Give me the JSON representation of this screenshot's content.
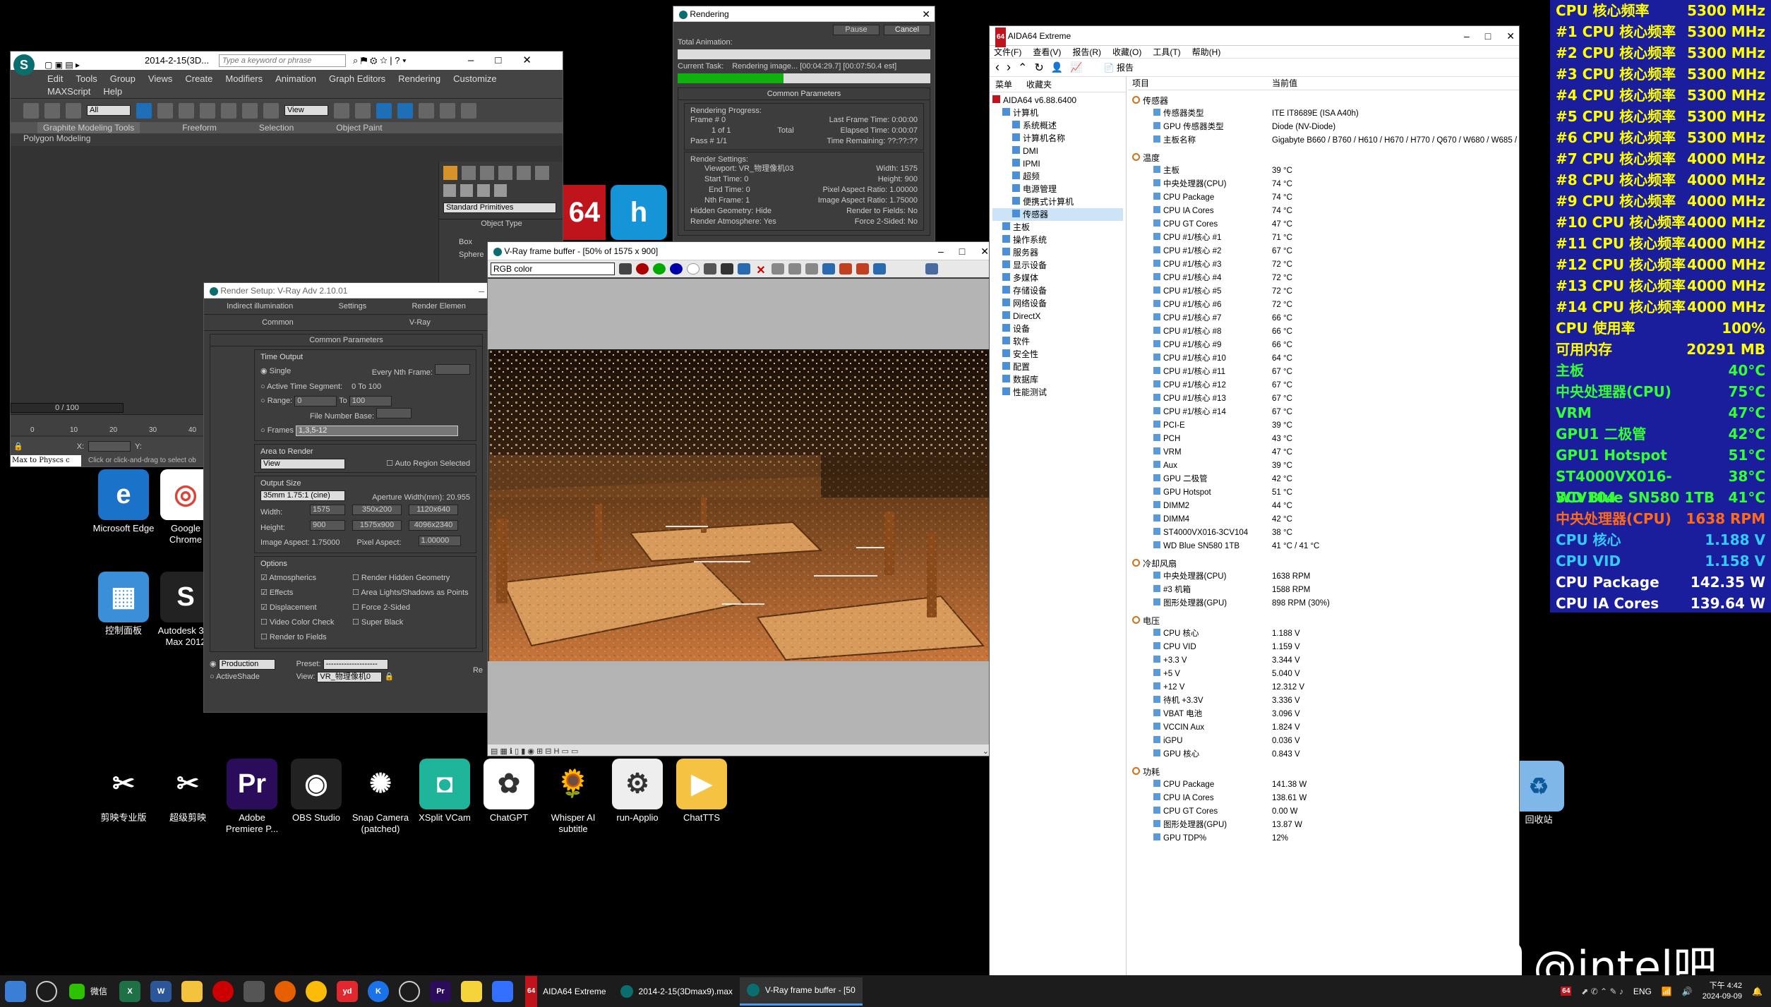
{
  "max": {
    "title": "2014-2-15(3D...",
    "search_placeholder": "Type a keyword or phrase",
    "menus": [
      "Edit",
      "Tools",
      "Group",
      "Views",
      "Create",
      "Modifiers",
      "Animation",
      "Graph Editors",
      "Rendering",
      "Customize"
    ],
    "menus2": [
      "MAXScript",
      "Help"
    ],
    "ribbon_tabs": [
      "Graphite Modeling Tools",
      "Freeform",
      "Selection",
      "Object Paint"
    ],
    "ribbon_sub": "Polygon Modeling",
    "view_dropdown": "View",
    "all_dropdown": "All",
    "frame_counter": "0 / 100",
    "timeline_ticks": [
      "0",
      "10",
      "20",
      "30",
      "40"
    ],
    "prompt": "Click or click-and-drag to select ob",
    "maxscript": "Max to Physcs c",
    "x_label": "X:",
    "y_label": "Y:",
    "standard_primitives": "Standard Primitives",
    "object_type": "Object Type",
    "box": "Box",
    "sphere": "Sphere"
  },
  "rendering": {
    "title": "Rendering",
    "pause": "Pause",
    "cancel": "Cancel",
    "total_animation": "Total Animation:",
    "current_task_label": "Current Task:",
    "current_task": "Rendering image... [00:04:29.7] [00:07:50.4 est]",
    "progress_fraction": 0.42,
    "common_params": "Common Parameters",
    "rendering_progress": "Rendering Progress:",
    "frame": "Frame #  0",
    "of": "1 of 1",
    "total": "Total",
    "pass": "Pass #  1/1",
    "last_frame_time": "Last Frame Time:  0:00:00",
    "elapsed_time": "Elapsed Time:  0:00:07",
    "time_remaining": "Time Remaining:  ??:??:??",
    "render_settings": "Render Settings:",
    "viewport": "Viewport:  VR_物理像机03",
    "width": "Width:  1575",
    "start_time": "Start Time:  0",
    "height": "Height:  900",
    "end_time": "End Time:  0",
    "pixel_aspect": "Pixel Aspect Ratio:  1.00000",
    "nth_frame": "Nth Frame:  1",
    "image_aspect": "Image Aspect Ratio:  1.75000",
    "hidden_geometry": "Hidden Geometry:  Hide",
    "render_to_fields": "Render to Fields:  No",
    "render_atmosphere": "Render Atmosphere:  Yes",
    "force_2sided": "Force 2-Sided:  No"
  },
  "rsetup": {
    "title": "Render Setup: V-Ray Adv 2.10.01",
    "tabs1": [
      "Indirect illumination",
      "Settings",
      "Render Elemen"
    ],
    "tabs2": [
      "Common",
      "V-Ray"
    ],
    "common_params": "Common Parameters",
    "time_output": "Time Output",
    "single": "Single",
    "every_nth": "Every Nth Frame:",
    "active_segment": "Active Time Segment:",
    "segment_value": "0 To 100",
    "range": "Range:",
    "range_from": "0",
    "range_to_label": "To",
    "range_to": "100",
    "file_number_base": "File Number Base:",
    "frames": "Frames",
    "frames_value": "1,3,5-12",
    "area_to_render": "Area to Render",
    "area_value": "View",
    "auto_region": "Auto Region Selected",
    "output_size": "Output Size",
    "camera_preset": "35mm 1.75:1 (cine)",
    "aperture": "Aperture Width(mm): 20.955",
    "width_label": "Width:",
    "width_val": "1575",
    "height_label": "Height:",
    "height_val": "900",
    "presets": [
      "350x200",
      "1120x640",
      "1575x900",
      "4096x2340"
    ],
    "image_aspect": "Image Aspect: 1.75000",
    "pixel_aspect": "Pixel Aspect:",
    "pixel_aspect_val": "1.00000",
    "options": "Options",
    "opts_left": [
      "Atmospherics",
      "Effects",
      "Displacement",
      "Video Color Check",
      "Render to Fields"
    ],
    "opts_left_checked": [
      true,
      true,
      true,
      false,
      false
    ],
    "opts_right": [
      "Render Hidden Geometry",
      "Area Lights/Shadows as Points",
      "Force 2-Sided",
      "Super Black"
    ],
    "production": "Production",
    "activeshade": "ActiveShade",
    "preset_label": "Preset:",
    "preset_val": "--------------------",
    "view_label": "View:",
    "view_val": "VR_物理像机0",
    "render_btn": "Re"
  },
  "vray": {
    "title": "V-Ray frame buffer - [50% of 1575 x 900]",
    "channel": "RGB color"
  },
  "aida": {
    "title": "AIDA64 Extreme",
    "menus": [
      "文件(F)",
      "查看(V)",
      "报告(R)",
      "收藏(O)",
      "工具(T)",
      "帮助(H)"
    ],
    "report": "报告",
    "left_tabs": [
      "菜单",
      "收藏夹"
    ],
    "col_item": "项目",
    "col_value": "当前值",
    "tree": [
      {
        "t": "AIDA64 v6.88.6400",
        "d": 0
      },
      {
        "t": "计算机",
        "d": 1
      },
      {
        "t": "系统概述",
        "d": 2
      },
      {
        "t": "计算机名称",
        "d": 2
      },
      {
        "t": "DMI",
        "d": 2
      },
      {
        "t": "IPMI",
        "d": 2
      },
      {
        "t": "超频",
        "d": 2
      },
      {
        "t": "电源管理",
        "d": 2
      },
      {
        "t": "便携式计算机",
        "d": 2
      },
      {
        "t": "传感器",
        "d": 2
      },
      {
        "t": "主板",
        "d": 1
      },
      {
        "t": "操作系统",
        "d": 1
      },
      {
        "t": "服务器",
        "d": 1
      },
      {
        "t": "显示设备",
        "d": 1
      },
      {
        "t": "多媒体",
        "d": 1
      },
      {
        "t": "存储设备",
        "d": 1
      },
      {
        "t": "网络设备",
        "d": 1
      },
      {
        "t": "DirectX",
        "d": 1
      },
      {
        "t": "设备",
        "d": 1
      },
      {
        "t": "软件",
        "d": 1
      },
      {
        "t": "安全性",
        "d": 1
      },
      {
        "t": "配置",
        "d": 1
      },
      {
        "t": "数据库",
        "d": 1
      },
      {
        "t": "性能测试",
        "d": 1
      }
    ],
    "sections": [
      {
        "name": "传感器",
        "rows": [
          [
            "传感器类型",
            "ITE IT8689E  (ISA A40h)"
          ],
          [
            "GPU 传感器类型",
            "Diode  (NV-Diode)"
          ],
          [
            "主板名称",
            "Gigabyte B660 / B760 / H610 / H670 / H770 / Q670 / W680 / W685 /"
          ]
        ]
      },
      {
        "name": "温度",
        "rows": [
          [
            "主板",
            "39 °C"
          ],
          [
            "中央处理器(CPU)",
            "74 °C"
          ],
          [
            "CPU Package",
            "74 °C"
          ],
          [
            "CPU IA Cores",
            "74 °C"
          ],
          [
            "CPU GT Cores",
            "47 °C"
          ],
          [
            "CPU #1/核心 #1",
            "71 °C"
          ],
          [
            "CPU #1/核心 #2",
            "67 °C"
          ],
          [
            "CPU #1/核心 #3",
            "72 °C"
          ],
          [
            "CPU #1/核心 #4",
            "72 °C"
          ],
          [
            "CPU #1/核心 #5",
            "72 °C"
          ],
          [
            "CPU #1/核心 #6",
            "72 °C"
          ],
          [
            "CPU #1/核心 #7",
            "66 °C"
          ],
          [
            "CPU #1/核心 #8",
            "66 °C"
          ],
          [
            "CPU #1/核心 #9",
            "66 °C"
          ],
          [
            "CPU #1/核心 #10",
            "64 °C"
          ],
          [
            "CPU #1/核心 #11",
            "67 °C"
          ],
          [
            "CPU #1/核心 #12",
            "67 °C"
          ],
          [
            "CPU #1/核心 #13",
            "67 °C"
          ],
          [
            "CPU #1/核心 #14",
            "67 °C"
          ],
          [
            "PCI-E",
            "39 °C"
          ],
          [
            "PCH",
            "43 °C"
          ],
          [
            "VRM",
            "47 °C"
          ],
          [
            "Aux",
            "39 °C"
          ],
          [
            "GPU 二极管",
            "42 °C"
          ],
          [
            "GPU Hotspot",
            "51 °C"
          ],
          [
            "DIMM2",
            "44 °C"
          ],
          [
            "DIMM4",
            "42 °C"
          ],
          [
            "ST4000VX016-3CV104",
            "38 °C"
          ],
          [
            "WD Blue SN580 1TB",
            "41 °C / 41 °C"
          ]
        ]
      },
      {
        "name": "冷却风扇",
        "rows": [
          [
            "中央处理器(CPU)",
            "1638 RPM"
          ],
          [
            "#3 机箱",
            "1588 RPM"
          ],
          [
            "图形处理器(GPU)",
            "898 RPM  (30%)"
          ]
        ]
      },
      {
        "name": "电压",
        "rows": [
          [
            "CPU 核心",
            "1.188 V"
          ],
          [
            "CPU VID",
            "1.159 V"
          ],
          [
            "+3.3 V",
            "3.344 V"
          ],
          [
            "+5 V",
            "5.040 V"
          ],
          [
            "+12 V",
            "12.312 V"
          ],
          [
            "待机 +3.3V",
            "3.336 V"
          ],
          [
            "VBAT 电池",
            "3.096 V"
          ],
          [
            "VCCIN Aux",
            "1.824 V"
          ],
          [
            "iGPU",
            "0.036 V"
          ],
          [
            "GPU 核心",
            "0.843 V"
          ]
        ]
      },
      {
        "name": "功耗",
        "rows": [
          [
            "CPU Package",
            "141.38 W"
          ],
          [
            "CPU IA Cores",
            "138.61 W"
          ],
          [
            "CPU GT Cores",
            "0.00 W"
          ],
          [
            "图形处理器(GPU)",
            "13.87 W"
          ],
          [
            "GPU TDP%",
            "12%"
          ]
        ]
      }
    ]
  },
  "osd": [
    {
      "k": "CPU 核心频率",
      "v": "5300 MHz",
      "c": "#ffff00"
    },
    {
      "k": "#1 CPU 核心频率",
      "v": "5300 MHz",
      "c": "#ffff00"
    },
    {
      "k": "#2 CPU 核心频率",
      "v": "5300 MHz",
      "c": "#ffff00"
    },
    {
      "k": "#3 CPU 核心频率",
      "v": "5300 MHz",
      "c": "#ffff00"
    },
    {
      "k": "#4 CPU 核心频率",
      "v": "5300 MHz",
      "c": "#ffff00"
    },
    {
      "k": "#5 CPU 核心频率",
      "v": "5300 MHz",
      "c": "#ffff00"
    },
    {
      "k": "#6 CPU 核心频率",
      "v": "5300 MHz",
      "c": "#ffff00"
    },
    {
      "k": "#7 CPU 核心频率",
      "v": "4000 MHz",
      "c": "#ffff00"
    },
    {
      "k": "#8 CPU 核心频率",
      "v": "4000 MHz",
      "c": "#ffff00"
    },
    {
      "k": "#9 CPU 核心频率",
      "v": "4000 MHz",
      "c": "#ffff00"
    },
    {
      "k": "#10 CPU 核心频率",
      "v": "4000 MHz",
      "c": "#ffff00"
    },
    {
      "k": "#11 CPU 核心频率",
      "v": "4000 MHz",
      "c": "#ffff00"
    },
    {
      "k": "#12 CPU 核心频率",
      "v": "4000 MHz",
      "c": "#ffff00"
    },
    {
      "k": "#13 CPU 核心频率",
      "v": "4000 MHz",
      "c": "#ffff00"
    },
    {
      "k": "#14 CPU 核心频率",
      "v": "4000 MHz",
      "c": "#ffff00"
    },
    {
      "k": "CPU 使用率",
      "v": "100%",
      "c": "#ffff00"
    },
    {
      "k": "可用内存",
      "v": "20291 MB",
      "c": "#ffff00"
    },
    {
      "k": "主板",
      "v": "40°C",
      "c": "#33ff33"
    },
    {
      "k": "中央处理器(CPU)",
      "v": "75°C",
      "c": "#33ff33"
    },
    {
      "k": "VRM",
      "v": "47°C",
      "c": "#33ff33"
    },
    {
      "k": "GPU1 二极管",
      "v": "42°C",
      "c": "#33ff33"
    },
    {
      "k": "GPU1 Hotspot",
      "v": "51°C",
      "c": "#33ff33"
    },
    {
      "k": "ST4000VX016-3CV104",
      "v": "38°C",
      "c": "#33ff33"
    },
    {
      "k": "WD Blue SN580 1TB",
      "v": "41°C",
      "c": "#33ff33"
    },
    {
      "k": "中央处理器(CPU)",
      "v": "1638 RPM",
      "c": "#ff6a1a"
    },
    {
      "k": "CPU 核心",
      "v": "1.188 V",
      "c": "#33ccff"
    },
    {
      "k": "CPU VID",
      "v": "1.158 V",
      "c": "#33ccff"
    },
    {
      "k": "CPU Package",
      "v": "142.35 W",
      "c": "#ffffff"
    },
    {
      "k": "CPU IA Cores",
      "v": "139.64 W",
      "c": "#ffffff"
    }
  ],
  "desktop_icons": [
    {
      "label": "Microsoft Edge",
      "bg": "#1a73c8",
      "glyph": "e"
    },
    {
      "label": "Google Chrome",
      "bg": "#fff",
      "glyph": "◎"
    },
    {
      "label": "控制面板",
      "bg": "#3a8fd8",
      "glyph": "▦"
    },
    {
      "label": "Autodesk 3ds Max 2012",
      "bg": "#222",
      "glyph": "S"
    }
  ],
  "bottom_icons": [
    {
      "label": "剪映专业版",
      "bg": "#000",
      "glyph": "✂"
    },
    {
      "label": "超级剪映",
      "bg": "#000",
      "glyph": "✂"
    },
    {
      "label": "Adobe Premiere P...",
      "bg": "#2a0c5a",
      "glyph": "Pr"
    },
    {
      "label": "OBS Studio",
      "bg": "#222",
      "glyph": "◉"
    },
    {
      "label": "Snap Camera (patched)",
      "bg": "#000",
      "glyph": "✺"
    },
    {
      "label": "XSplit VCam",
      "bg": "#1fb59a",
      "glyph": "◘"
    },
    {
      "label": "ChatGPT",
      "bg": "#fff",
      "glyph": "✿"
    },
    {
      "label": "Whisper AI subtitle",
      "bg": "#000",
      "glyph": "🌻"
    },
    {
      "label": "run-Applio",
      "bg": "#eee",
      "glyph": "⚙"
    },
    {
      "label": "ChatTTS",
      "bg": "#f5c242",
      "glyph": "▶"
    }
  ],
  "recycle": "回收站",
  "watermark": "@intel吧",
  "taskbar": {
    "apps": [
      "AIDA64 Extreme",
      "2014-2-15(3Dmax9).max",
      "V-Ray frame buffer - [50"
    ],
    "wechat": "微信",
    "lang": "ENG",
    "time": "下午 4:42",
    "date": "2024-09-09"
  }
}
